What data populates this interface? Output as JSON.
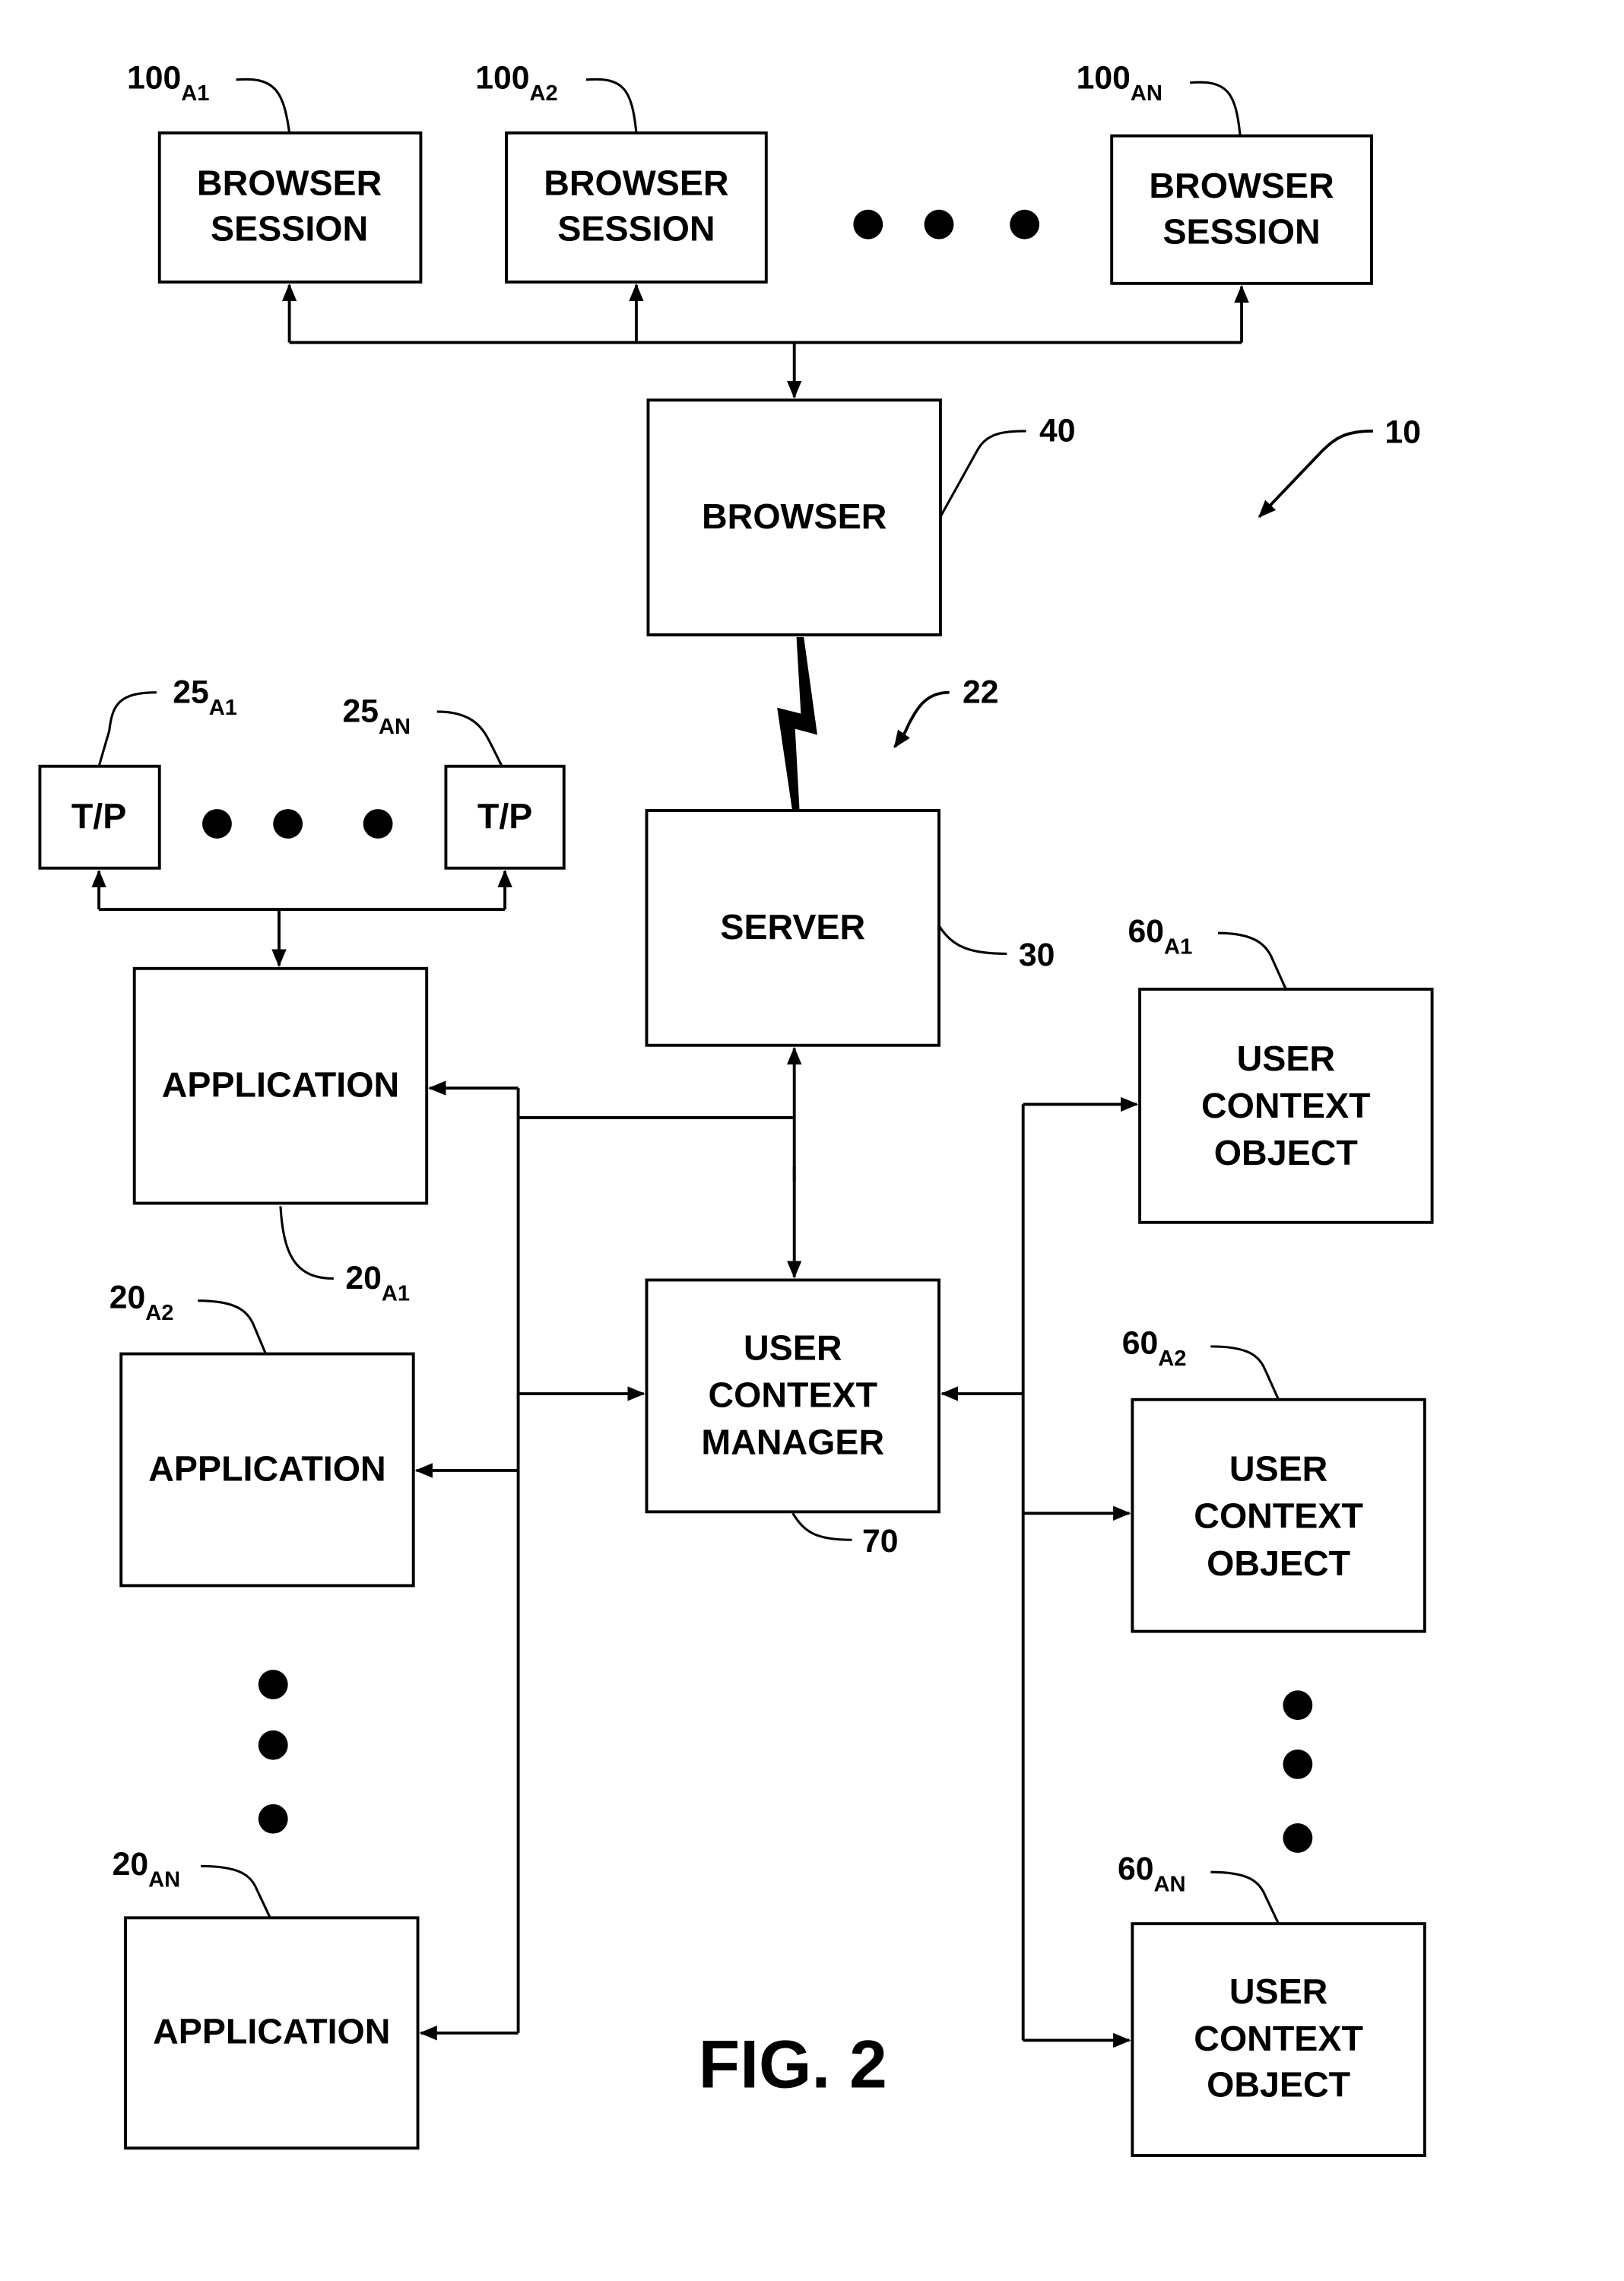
{
  "figure": {
    "caption": "FIG. 2",
    "system_ref": "10",
    "network_ref": "22"
  },
  "browser_sessions": {
    "items": [
      {
        "lines": [
          "BROWSER",
          "SESSION"
        ],
        "ref": "100",
        "sub": "A1"
      },
      {
        "lines": [
          "BROWSER",
          "SESSION"
        ],
        "ref": "100",
        "sub": "A2"
      },
      {
        "lines": [
          "BROWSER",
          "SESSION"
        ],
        "ref": "100",
        "sub": "AN"
      }
    ]
  },
  "browser": {
    "label": "BROWSER",
    "ref": "40"
  },
  "server": {
    "label": "SERVER",
    "ref": "30"
  },
  "user_context_manager": {
    "lines": [
      "USER",
      "CONTEXT",
      "MANAGER"
    ],
    "ref": "70"
  },
  "tp_devices": {
    "items": [
      {
        "label": "T/P",
        "ref": "25",
        "sub": "A1"
      },
      {
        "label": "T/P",
        "ref": "25",
        "sub": "AN"
      }
    ]
  },
  "applications": {
    "items": [
      {
        "label": "APPLICATION",
        "ref": "20",
        "sub": "A1"
      },
      {
        "label": "APPLICATION",
        "ref": "20",
        "sub": "A2"
      },
      {
        "label": "APPLICATION",
        "ref": "20",
        "sub": "AN"
      }
    ]
  },
  "user_context_objects": {
    "items": [
      {
        "lines": [
          "USER",
          "CONTEXT",
          "OBJECT"
        ],
        "ref": "60",
        "sub": "A1"
      },
      {
        "lines": [
          "USER",
          "CONTEXT",
          "OBJECT"
        ],
        "ref": "60",
        "sub": "A2"
      },
      {
        "lines": [
          "USER",
          "CONTEXT",
          "OBJECT"
        ],
        "ref": "60",
        "sub": "AN"
      }
    ]
  },
  "ellipsis_groups": [
    "browser-sessions",
    "tp-devices",
    "applications",
    "user-context-objects"
  ]
}
